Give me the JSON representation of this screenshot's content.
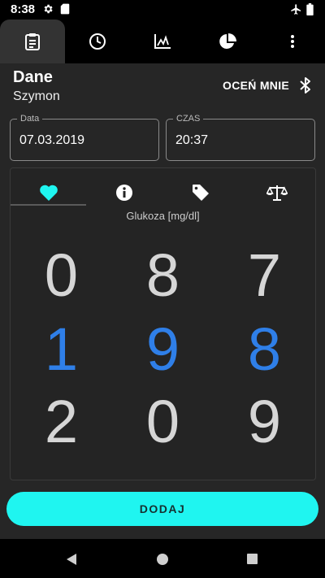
{
  "status_bar": {
    "time": "8:38",
    "icons": [
      "gear-icon",
      "sd-card-icon",
      "airplane-icon",
      "battery-icon"
    ]
  },
  "tabs": [
    {
      "name": "clipboard-icon",
      "active": true
    },
    {
      "name": "clock-icon",
      "active": false
    },
    {
      "name": "chart-icon",
      "active": false
    },
    {
      "name": "pie-chart-icon",
      "active": false
    },
    {
      "name": "overflow-menu-icon",
      "active": false
    }
  ],
  "header": {
    "title": "Dane",
    "subtitle": "Szymon",
    "rate_label": "OCEŃ MNIE",
    "bluetooth_icon": "bluetooth-icon"
  },
  "date_field": {
    "label": "Data",
    "value": "07.03.2019"
  },
  "time_field": {
    "label": "CZAS",
    "value": "20:37"
  },
  "panel": {
    "tabs": [
      "heart-icon",
      "info-icon",
      "tag-icon",
      "scale-icon"
    ],
    "active_tab": 0,
    "label": "Glukoza [mg/dl]",
    "digits": [
      {
        "value": "0",
        "selected": false
      },
      {
        "value": "8",
        "selected": false
      },
      {
        "value": "7",
        "selected": false
      },
      {
        "value": "1",
        "selected": true
      },
      {
        "value": "9",
        "selected": true
      },
      {
        "value": "8",
        "selected": true
      },
      {
        "value": "2",
        "selected": false
      },
      {
        "value": "0",
        "selected": false
      },
      {
        "value": "9",
        "selected": false
      }
    ]
  },
  "add_button": {
    "label": "DODAJ"
  },
  "colors": {
    "accent": "#1ff5f0",
    "selected_digit": "#2f7fe8",
    "background": "#262626"
  }
}
